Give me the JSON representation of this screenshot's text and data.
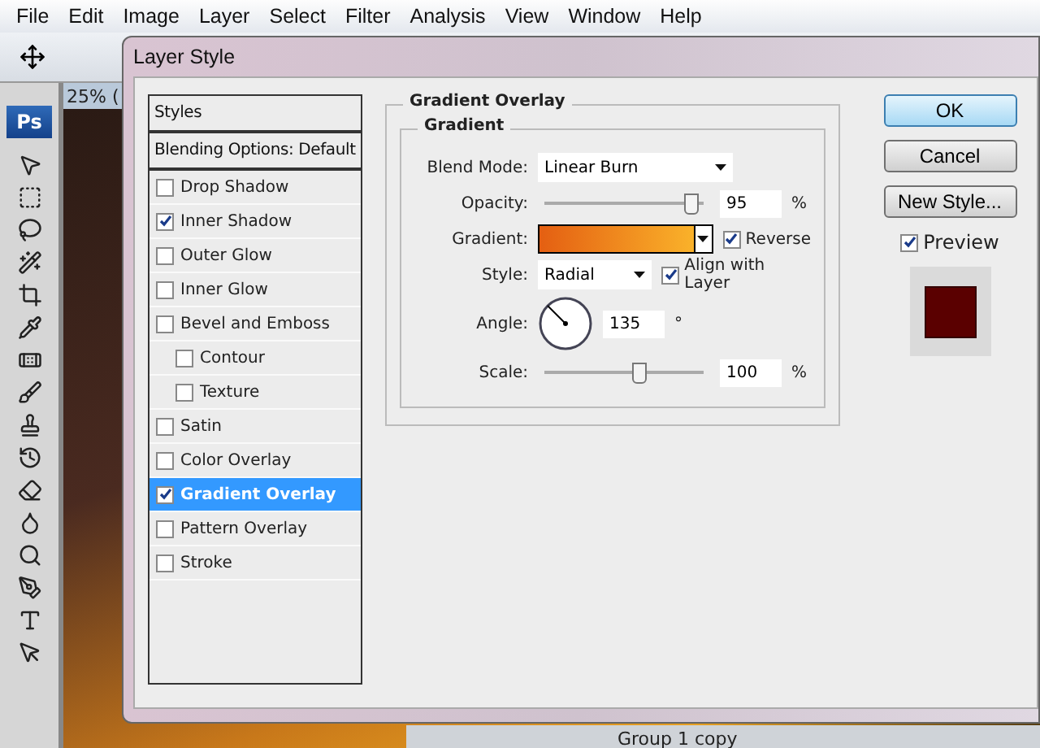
{
  "menu": [
    "File",
    "Edit",
    "Image",
    "Layer",
    "Select",
    "Filter",
    "Analysis",
    "View",
    "Window",
    "Help"
  ],
  "toolbox": {
    "logo": "Ps"
  },
  "document": {
    "tab_label": "25% ("
  },
  "layers_panel": {
    "layer_name": "Group 1 copy"
  },
  "dialog": {
    "title": "Layer Style",
    "styles_header": "Styles",
    "blending_header": "Blending Options: Default",
    "effects": [
      {
        "label": "Drop Shadow",
        "checked": false,
        "selected": false
      },
      {
        "label": "Inner Shadow",
        "checked": true,
        "selected": false
      },
      {
        "label": "Outer Glow",
        "checked": false,
        "selected": false
      },
      {
        "label": "Inner Glow",
        "checked": false,
        "selected": false
      },
      {
        "label": "Bevel and Emboss",
        "checked": false,
        "selected": false,
        "children": [
          {
            "label": "Contour",
            "checked": false,
            "selected": false
          },
          {
            "label": "Texture",
            "checked": false,
            "selected": false
          }
        ]
      },
      {
        "label": "Satin",
        "checked": false,
        "selected": false
      },
      {
        "label": "Color Overlay",
        "checked": false,
        "selected": false
      },
      {
        "label": "Gradient Overlay",
        "checked": true,
        "selected": true
      },
      {
        "label": "Pattern Overlay",
        "checked": false,
        "selected": false
      },
      {
        "label": "Stroke",
        "checked": false,
        "selected": false
      }
    ],
    "section_title": "Gradient Overlay",
    "group_title": "Gradient",
    "blend_mode": {
      "label": "Blend Mode:",
      "value": "Linear Burn"
    },
    "opacity": {
      "label": "Opacity:",
      "level": 0.95,
      "value": "95",
      "unit": "%"
    },
    "gradient": {
      "label": "Gradient:",
      "reverse": {
        "label": "Reverse",
        "checked": true
      }
    },
    "style": {
      "label": "Style:",
      "value": "Radial",
      "align": {
        "label": "Align with Layer",
        "checked": true
      }
    },
    "angle": {
      "label": "Angle:",
      "value": "135",
      "unit": "°"
    },
    "scale": {
      "label": "Scale:",
      "level": 0.6,
      "value": "100",
      "unit": "%"
    },
    "buttons": [
      {
        "label": "OK",
        "default": true
      },
      {
        "label": "Cancel",
        "default": false
      },
      {
        "label": "New Style...",
        "default": false
      }
    ],
    "preview": {
      "label": "Preview",
      "checked": true
    }
  }
}
